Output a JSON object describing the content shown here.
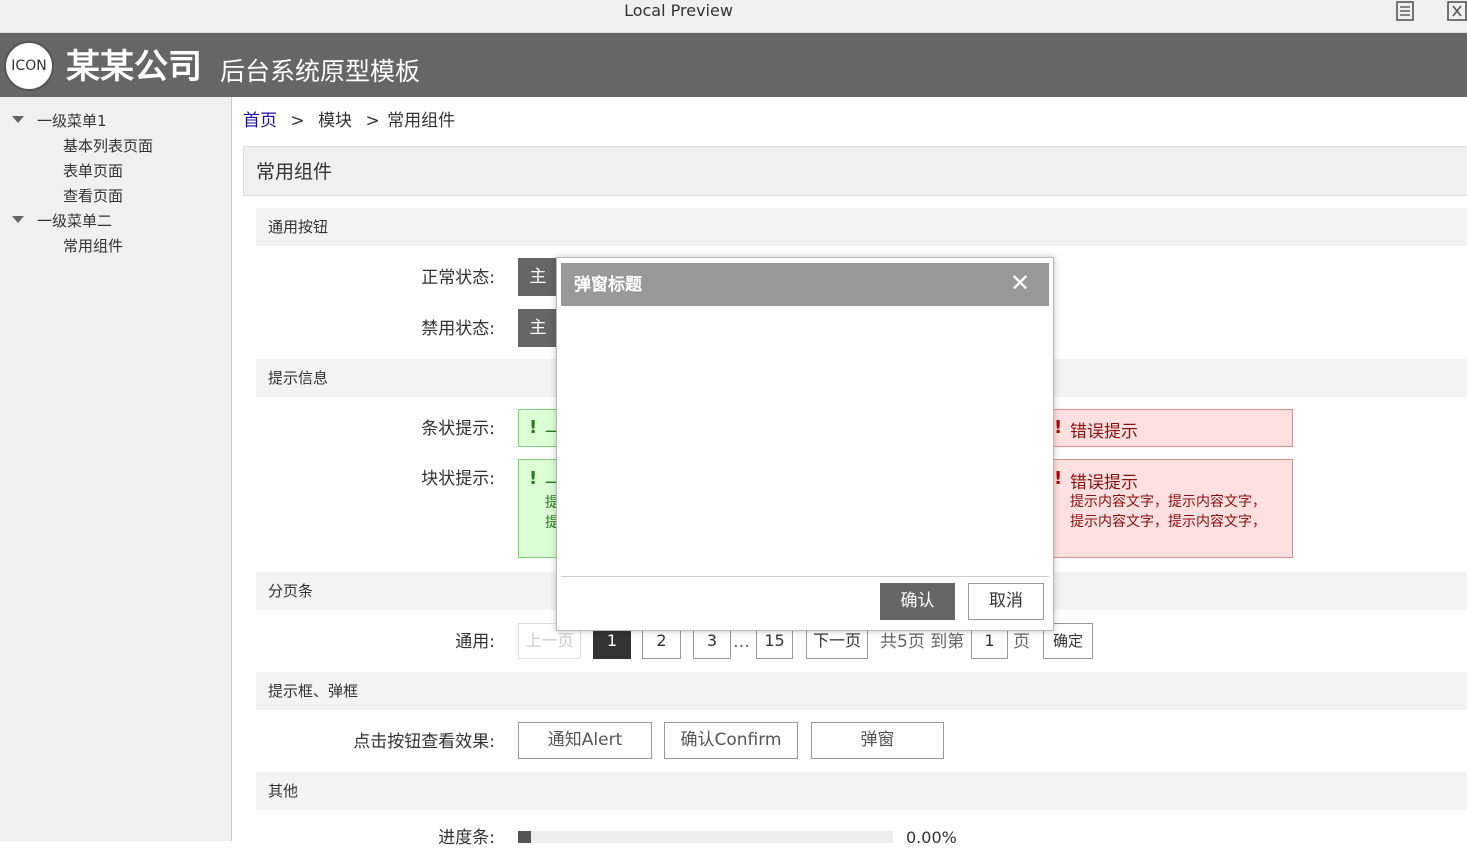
{
  "preview": {
    "title": "Local Preview",
    "icons": [
      "document-icon",
      "close-panel-icon"
    ]
  },
  "header": {
    "logo": "ICON",
    "company": "某某公司",
    "system": "后台系统原型模板",
    "bg_color": "#666666"
  },
  "sidebar": {
    "groups": [
      {
        "label": "一级菜单1",
        "items": [
          "基本列表页面",
          "表单页面",
          "查看页面"
        ]
      },
      {
        "label": "一级菜单二",
        "items": [
          "常用组件"
        ]
      }
    ]
  },
  "breadcrumb": {
    "home": "首页",
    "sep1": ">",
    "module": "模块",
    "sep2": ">",
    "current": "常用组件"
  },
  "page": {
    "title": "常用组件"
  },
  "sections": {
    "buttons": {
      "title": "通用按钮",
      "normal_label": "正常状态:",
      "disabled_label": "禁用状态:",
      "btn_text": "主"
    },
    "alerts": {
      "title": "提示信息",
      "bar_label": "条状提示:",
      "block_label": "块状提示:",
      "success_prefix": "一",
      "success_line1_prefix": "提",
      "success_line2_prefix": "提",
      "error_title": "错误提示",
      "error_text1": "提示内容文字，提示内容文字，",
      "error_text2": "提示内容文字，提示内容文字，"
    },
    "pagination": {
      "title": "分页条",
      "label": "通用:",
      "prev": "上一页",
      "pages": [
        "1",
        "2",
        "3"
      ],
      "ellipsis": "…",
      "last": "15",
      "next": "下一页",
      "total_text": "共5页 到第",
      "page_input": "1",
      "page_unit": "页",
      "confirm": "确定"
    },
    "dialogs": {
      "title": "提示框、弹框",
      "label": "点击按钮查看效果:",
      "alert_btn": "通知Alert",
      "confirm_btn": "确认Confirm",
      "modal_btn": "弹窗"
    },
    "others": {
      "title": "其他",
      "progress_label": "进度条:",
      "progress_value": 0.0,
      "progress_text": "0.00%"
    }
  },
  "modal": {
    "title": "弹窗标题",
    "close": "✕",
    "ok": "确认",
    "cancel": "取消"
  }
}
